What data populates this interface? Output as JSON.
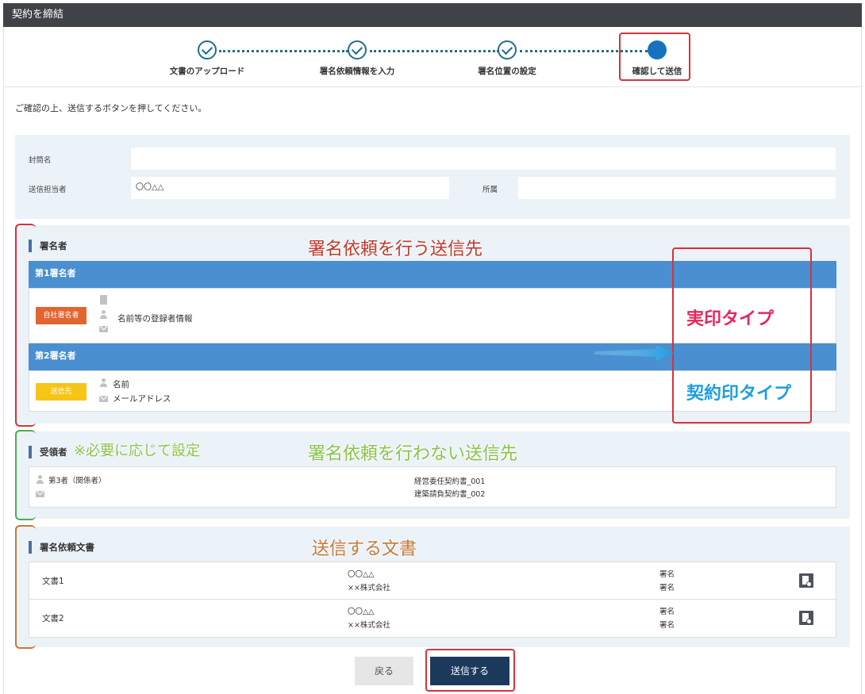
{
  "window": {
    "title": "契約を締結"
  },
  "steps": [
    {
      "label": "文書のアップロード",
      "state": "done"
    },
    {
      "label": "署名依頼情報を入力",
      "state": "done"
    },
    {
      "label": "署名位置の設定",
      "state": "done"
    },
    {
      "label": "確認して送信",
      "state": "current"
    }
  ],
  "intro": "ご確認の上、送信するボタンを押してください。",
  "envelope": {
    "name_label": "封筒名",
    "name_value": "",
    "sender_label": "送信担当者",
    "sender_value": "〇〇△△",
    "dept_label": "所属",
    "dept_value": ""
  },
  "signers": {
    "title": "署名者",
    "first": {
      "header": "第1署名者",
      "badge": "自社署名者",
      "info": "名前等の登録者情報"
    },
    "second": {
      "header": "第2署名者",
      "badge": "送信先",
      "name": "名前",
      "email": "メールアドレス"
    }
  },
  "recipients": {
    "title": "受領者",
    "person": "第3者（関係者）",
    "docs": [
      "経営委任契約書_001",
      "建築請負契約書_002"
    ]
  },
  "documents": {
    "title": "署名依頼文書",
    "rows": [
      {
        "name": "文書1",
        "party1": "〇〇△△",
        "party2": "××株式会社",
        "sig1": "署名",
        "sig2": "署名"
      },
      {
        "name": "文書2",
        "party1": "〇〇△△",
        "party2": "××株式会社",
        "sig1": "署名",
        "sig2": "署名"
      }
    ]
  },
  "buttons": {
    "back": "戻る",
    "send": "送信する"
  },
  "annotations": {
    "signers": "署名依頼を行う送信先",
    "jitsuin": "実印タイプ",
    "keiyakuin": "契約印タイプ",
    "recipients_note": "※必要に応じて設定",
    "recipients": "署名依頼を行わない送信先",
    "documents": "送信する文書"
  },
  "colors": {
    "titlebar": "#3f4247",
    "step": "#1e6f8a",
    "step_current": "#1672be",
    "signer_bar": "#4a8fd0",
    "badge_own": "#e2652f",
    "badge_recipient": "#f5c518",
    "send_button": "#1b3a5c",
    "back_button": "#e6e6e6",
    "highlight_red": "#d9323a",
    "annot_red": "#c0392b",
    "annot_pink": "#e8265c",
    "annot_blue": "#1d9ee0",
    "annot_green": "#8bc34a",
    "annot_brown": "#c47a3a"
  }
}
